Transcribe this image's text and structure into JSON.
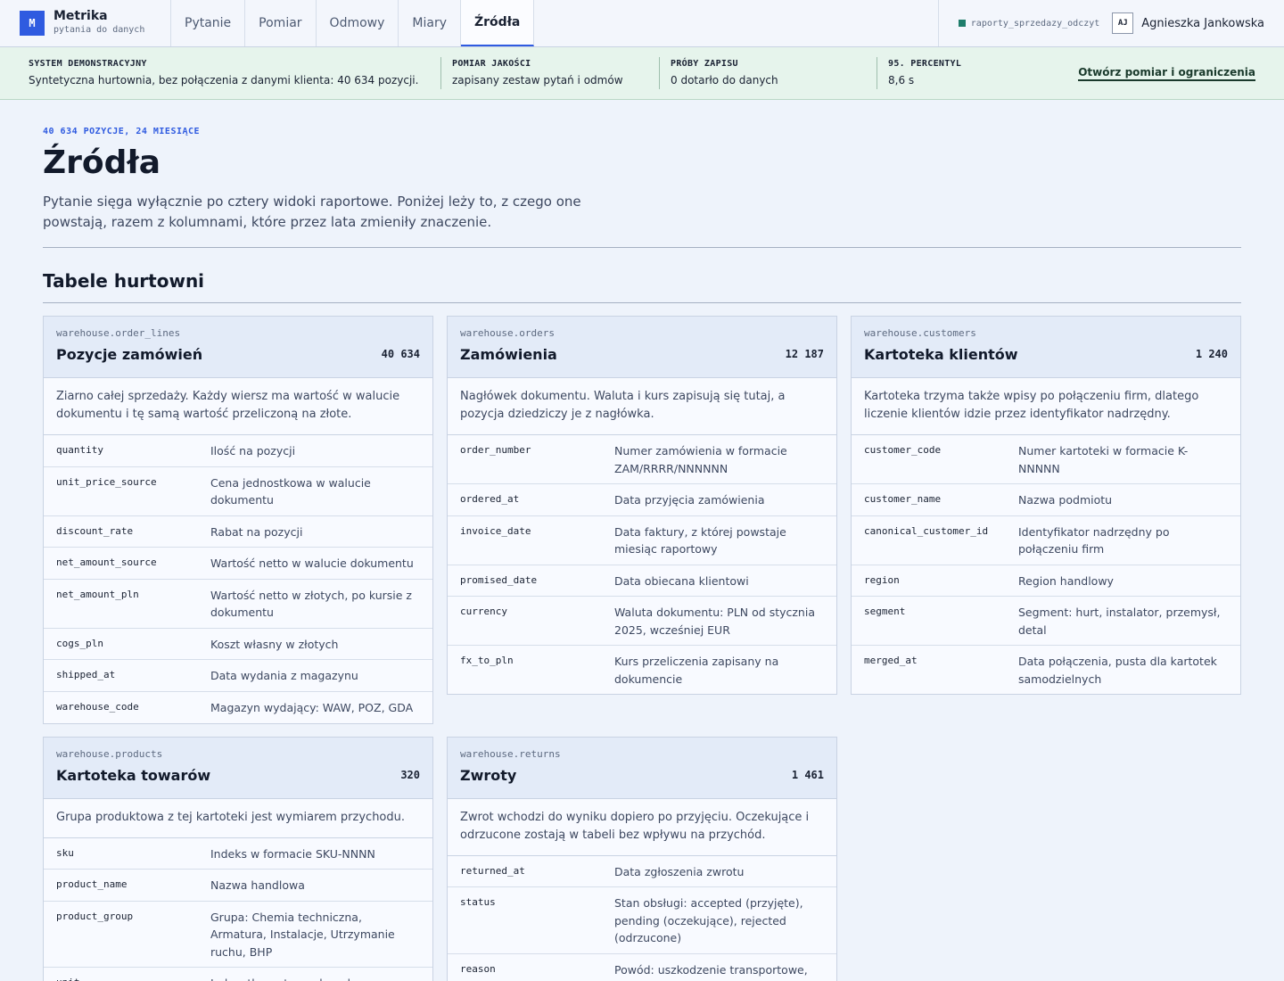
{
  "app": {
    "logo_letter": "M",
    "name": "Metrika",
    "subtitle": "pytania do danych"
  },
  "nav": {
    "items": [
      {
        "label": "Pytanie"
      },
      {
        "label": "Pomiar"
      },
      {
        "label": "Odmowy"
      },
      {
        "label": "Miary"
      },
      {
        "label": "Źródła",
        "active": true
      }
    ]
  },
  "connection": {
    "label": "raporty_sprzedazy_odczyt",
    "status_color": "#1e7d6b"
  },
  "user": {
    "initials": "AJ",
    "name": "Agnieszka Jankowska"
  },
  "status_strip": {
    "items": [
      {
        "label": "SYSTEM DEMONSTRACYJNY",
        "value": "Syntetyczna hurtownia, bez połączenia z danymi klienta: 40 634 pozycji."
      },
      {
        "label": "POMIAR JAKOŚCI",
        "value": "zapisany zestaw pytań i odmów"
      },
      {
        "label": "PRÓBY ZAPISU",
        "value": "0 dotarło do danych"
      },
      {
        "label": "95. PERCENTYL",
        "value": "8,6 s"
      }
    ],
    "link": "Otwórz pomiar i ograniczenia"
  },
  "page": {
    "eyebrow": "40 634 POZYCJE, 24 MIESIĄCE",
    "title": "Źródła",
    "description": "Pytanie sięga wyłącznie po cztery widoki raportowe. Poniżej leży to, z czego one powstają, razem z kolumnami, które przez lata zmieniły znaczenie.",
    "section_title": "Tabele hurtowni"
  },
  "tables": [
    {
      "key": "warehouse.order_lines",
      "title": "Pozycje zamówień",
      "count": "40 634",
      "description": "Ziarno całej sprzedaży. Każdy wiersz ma wartość w walucie dokumentu i tę samą wartość przeliczoną na złote.",
      "columns": [
        {
          "name": "quantity",
          "desc": "Ilość na pozycji"
        },
        {
          "name": "unit_price_source",
          "desc": "Cena jednostkowa w walucie dokumentu"
        },
        {
          "name": "discount_rate",
          "desc": "Rabat na pozycji"
        },
        {
          "name": "net_amount_source",
          "desc": "Wartość netto w walucie dokumentu"
        },
        {
          "name": "net_amount_pln",
          "desc": "Wartość netto w złotych, po kursie z dokumentu"
        },
        {
          "name": "cogs_pln",
          "desc": "Koszt własny w złotych"
        },
        {
          "name": "shipped_at",
          "desc": "Data wydania z magazynu"
        },
        {
          "name": "warehouse_code",
          "desc": "Magazyn wydający: WAW, POZ, GDA"
        }
      ]
    },
    {
      "key": "warehouse.orders",
      "title": "Zamówienia",
      "count": "12 187",
      "description": "Nagłówek dokumentu. Waluta i kurs zapisują się tutaj, a pozycja dziedziczy je z nagłówka.",
      "columns": [
        {
          "name": "order_number",
          "desc": "Numer zamówienia w formacie ZAM/RRRR/NNNNNN"
        },
        {
          "name": "ordered_at",
          "desc": "Data przyjęcia zamówienia"
        },
        {
          "name": "invoice_date",
          "desc": "Data faktury, z której powstaje miesiąc raportowy"
        },
        {
          "name": "promised_date",
          "desc": "Data obiecana klientowi"
        },
        {
          "name": "currency",
          "desc": "Waluta dokumentu: PLN od stycznia 2025, wcześniej EUR"
        },
        {
          "name": "fx_to_pln",
          "desc": "Kurs przeliczenia zapisany na dokumencie"
        }
      ]
    },
    {
      "key": "warehouse.customers",
      "title": "Kartoteka klientów",
      "count": "1 240",
      "description": "Kartoteka trzyma także wpisy po połączeniu firm, dlatego liczenie klientów idzie przez identyfikator nadrzędny.",
      "columns": [
        {
          "name": "customer_code",
          "desc": "Numer kartoteki w formacie K-NNNNN"
        },
        {
          "name": "customer_name",
          "desc": "Nazwa podmiotu"
        },
        {
          "name": "canonical_customer_id",
          "desc": "Identyfikator nadrzędny po połączeniu firm"
        },
        {
          "name": "region",
          "desc": "Region handlowy"
        },
        {
          "name": "segment",
          "desc": "Segment: hurt, instalator, przemysł, detal"
        },
        {
          "name": "merged_at",
          "desc": "Data połączenia, pusta dla kartotek samodzielnych"
        }
      ]
    },
    {
      "key": "warehouse.products",
      "title": "Kartoteka towarów",
      "count": "320",
      "description": "Grupa produktowa z tej kartoteki jest wymiarem przychodu.",
      "columns": [
        {
          "name": "sku",
          "desc": "Indeks w formacie SKU-NNNN"
        },
        {
          "name": "product_name",
          "desc": "Nazwa handlowa"
        },
        {
          "name": "product_group",
          "desc": "Grupa: Chemia techniczna, Armatura, Instalacje, Utrzymanie ruchu, BHP"
        },
        {
          "name": "unit",
          "desc": "Jednostka: szt., opak., mb"
        }
      ]
    },
    {
      "key": "warehouse.returns",
      "title": "Zwroty",
      "count": "1 461",
      "description": "Zwrot wchodzi do wyniku dopiero po przyjęciu. Oczekujące i odrzucone zostają w tabeli bez wpływu na przychód.",
      "columns": [
        {
          "name": "returned_at",
          "desc": "Data zgłoszenia zwrotu"
        },
        {
          "name": "status",
          "desc": "Stan obsługi: accepted (przyjęte), pending (oczekujące), rejected (odrzucone)"
        },
        {
          "name": "reason",
          "desc": "Powód: uszkodzenie transportowe, błędny indeks, pomyłka zamówienia"
        }
      ]
    }
  ]
}
